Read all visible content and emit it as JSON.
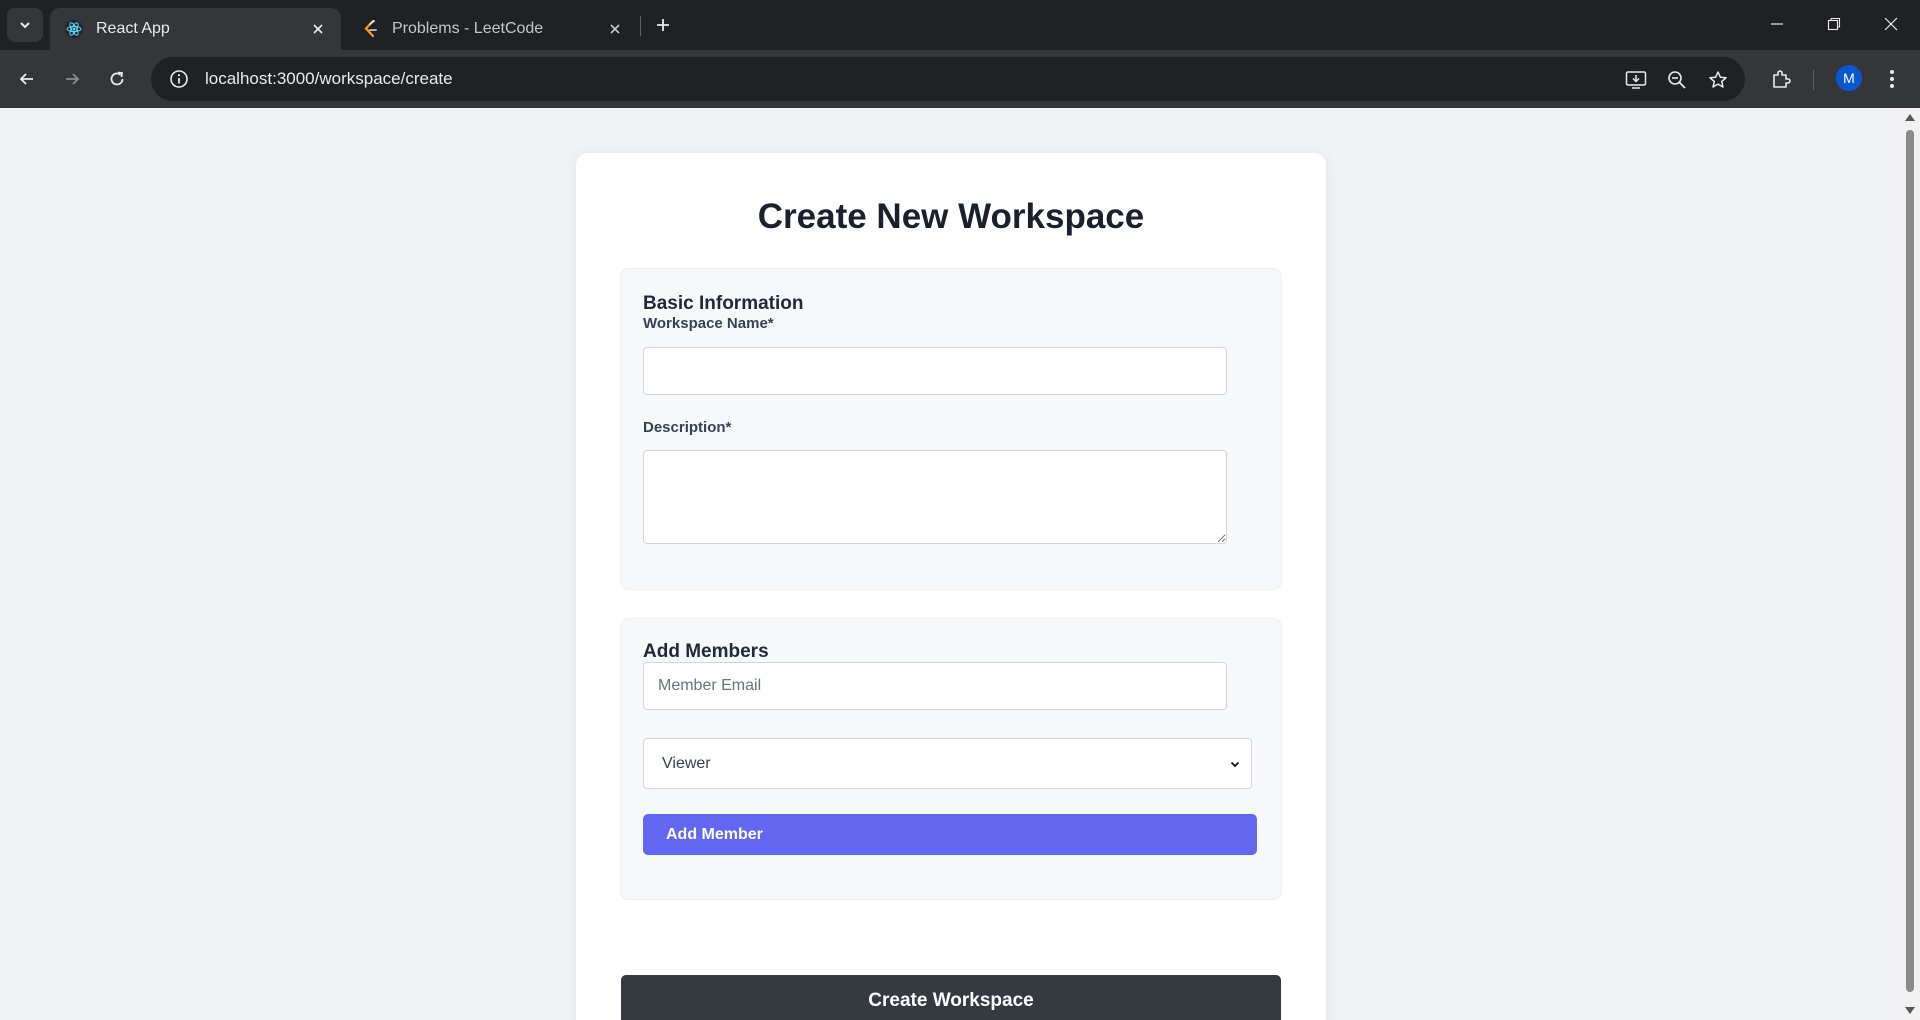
{
  "browser": {
    "tabs": [
      {
        "title": "React App",
        "icon": "react-icon",
        "active": true
      },
      {
        "title": "Problems - LeetCode",
        "icon": "leetcode-icon",
        "active": false
      }
    ],
    "url": "localhost:3000/workspace/create",
    "profile_initial": "M"
  },
  "form": {
    "title": "Create New Workspace",
    "basic_info": {
      "heading": "Basic Information",
      "name_label": "Workspace Name*",
      "name_value": "",
      "description_label": "Description*",
      "description_value": ""
    },
    "members": {
      "heading": "Add Members",
      "email_placeholder": "Member Email",
      "role_selected": "Viewer",
      "add_button": "Add Member"
    },
    "submit_button": "Create Workspace"
  },
  "colors": {
    "accent": "#6366f1",
    "submit": "#343a40",
    "page_bg": "#f0f2f5"
  }
}
